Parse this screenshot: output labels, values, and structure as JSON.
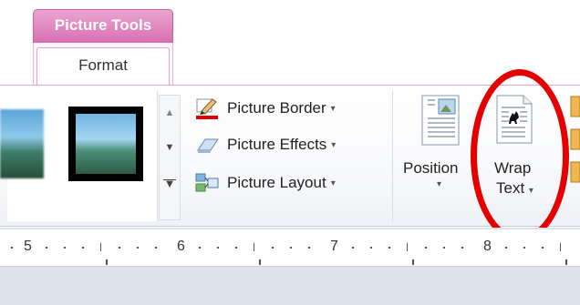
{
  "context_tab": {
    "title": "Picture Tools",
    "color": "#d86fb3"
  },
  "tabs": [
    {
      "label": "Format",
      "active": true
    }
  ],
  "picture_styles": {
    "gallery_items": [
      "picture-style-soft-edge",
      "picture-style-black-frame"
    ]
  },
  "commands": {
    "picture_border": "Picture Border",
    "picture_effects": "Picture Effects",
    "picture_layout": "Picture Layout",
    "dropdown_glyph": "▾"
  },
  "arrange": {
    "position_label": "Position",
    "wrap_label_line1": "Wrap",
    "wrap_label_line2": "Text",
    "dropdown_glyph": "▾"
  },
  "annotation": {
    "shape": "oval",
    "color": "#e40000",
    "target": "Wrap Text"
  },
  "ruler": {
    "numbers": [
      "5",
      "6",
      "7",
      "8"
    ]
  }
}
